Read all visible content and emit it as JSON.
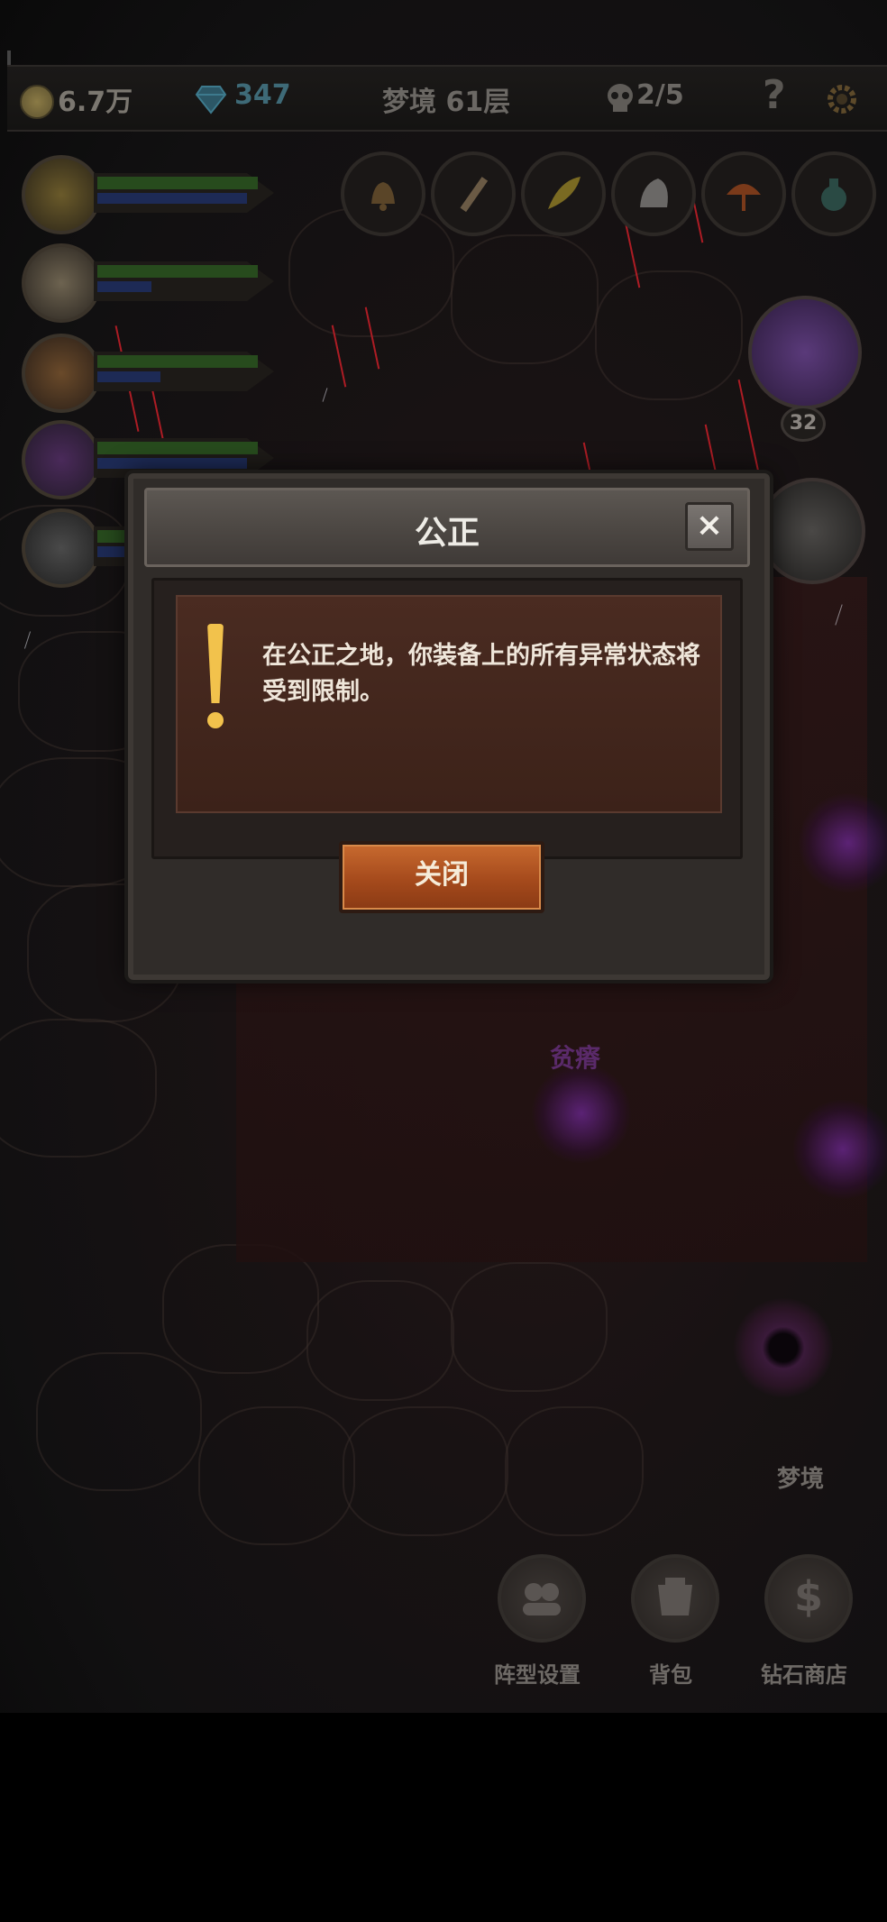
{
  "topbar": {
    "gold": "6.7万",
    "diamonds": "347",
    "floor": "梦境 61层",
    "kills": "2/5",
    "help": "?"
  },
  "heroes": [
    {
      "name": "hero-1"
    },
    {
      "name": "hero-2"
    },
    {
      "name": "hero-3"
    },
    {
      "name": "hero-4"
    },
    {
      "name": "hero-5"
    }
  ],
  "boss": {
    "level": "32"
  },
  "map": {
    "node_labels": [
      "贫瘠",
      "梦境"
    ]
  },
  "bottom": {
    "formation": "阵型设置",
    "bag": "背包",
    "shop": "钻石商店",
    "shop_symbol": "$"
  },
  "modal": {
    "title": "公正",
    "close_x": "×",
    "message": "在公正之地，你装备上的所有异常状态将受到限制。",
    "close_button": "关闭"
  },
  "colors": {
    "warning": "#f2c24c",
    "button": "#b5561f",
    "panel": "#43271d"
  }
}
